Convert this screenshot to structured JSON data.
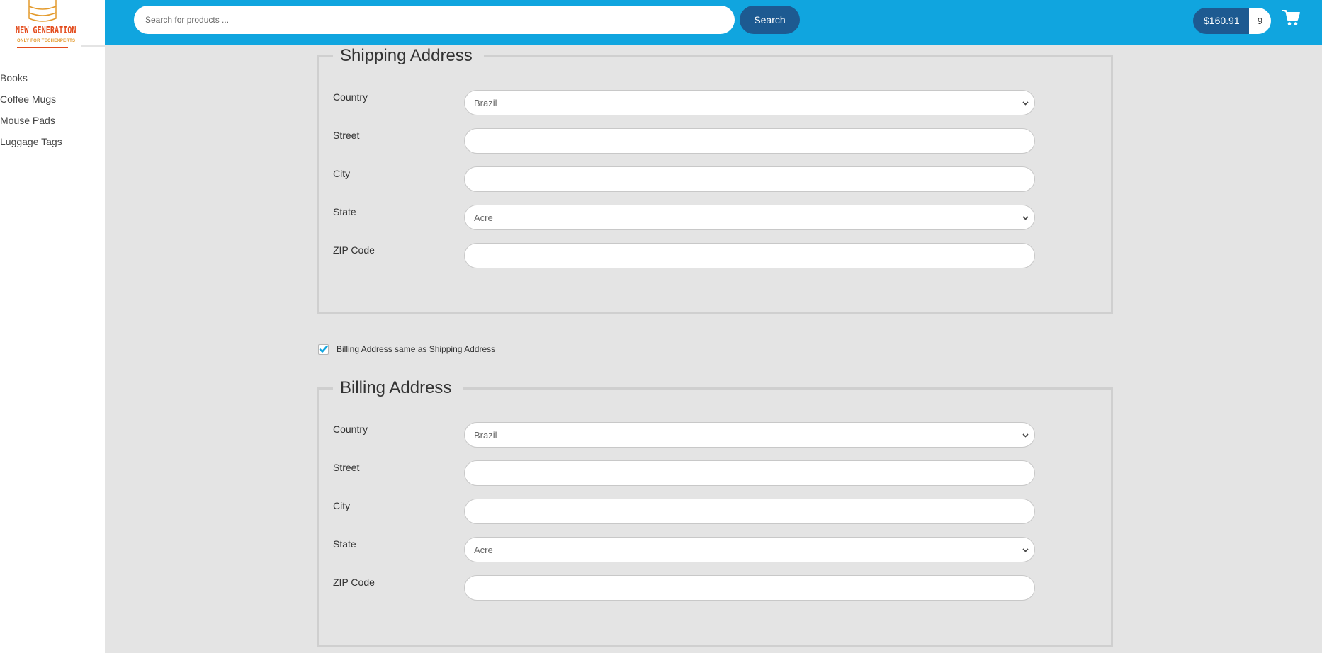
{
  "brand": {
    "name": "NEW GENERATION",
    "tagline": "ONLY FOR TECHEXPERTS",
    "colors": {
      "primary": "#e34b1c",
      "accent": "#e39a2c"
    }
  },
  "header": {
    "background": "#10a5df",
    "search_placeholder": "Search for products ...",
    "search_button": "Search",
    "cart_total": "$160.91",
    "cart_count": "9",
    "cart_icon": "shopping-cart-icon"
  },
  "sidebar": {
    "categories": [
      {
        "label": "Books"
      },
      {
        "label": "Coffee Mugs"
      },
      {
        "label": "Mouse Pads"
      },
      {
        "label": "Luggage Tags"
      }
    ]
  },
  "shipping": {
    "legend": "Shipping Address",
    "fields": {
      "country": {
        "label": "Country",
        "value": "Brazil"
      },
      "street": {
        "label": "Street",
        "value": ""
      },
      "city": {
        "label": "City",
        "value": ""
      },
      "state": {
        "label": "State",
        "value": "Acre"
      },
      "zip": {
        "label": "ZIP Code",
        "value": ""
      }
    }
  },
  "same_as_shipping": {
    "label": "Billing Address same as Shipping Address",
    "checked": true
  },
  "billing": {
    "legend": "Billing Address",
    "fields": {
      "country": {
        "label": "Country",
        "value": "Brazil"
      },
      "street": {
        "label": "Street",
        "value": ""
      },
      "city": {
        "label": "City",
        "value": ""
      },
      "state": {
        "label": "State",
        "value": "Acre"
      },
      "zip": {
        "label": "ZIP Code",
        "value": ""
      }
    }
  }
}
